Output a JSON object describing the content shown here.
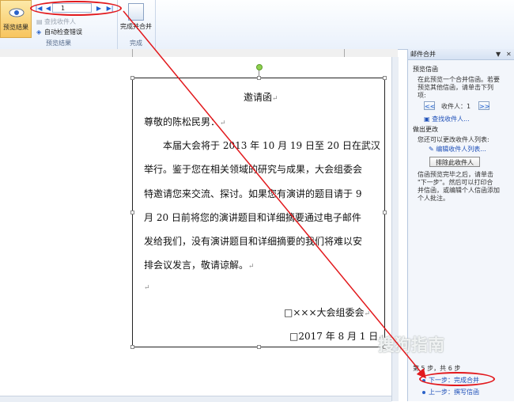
{
  "ribbon": {
    "preview_results": {
      "label": "预览结果"
    },
    "record": {
      "value": "1"
    },
    "find_recipient": "查找收件人",
    "auto_check": "自动检查错误",
    "group_preview": "预览结果",
    "finish_merge": "完成并合并",
    "group_finish": "完成"
  },
  "document": {
    "title": "邀请函",
    "greeting": "尊敬的陈松民男：",
    "lines": [
      "本届大会将于 2013 年 10 月 19 日至 20 日在武汉",
      "举行。鉴于您在相关领域的研究与成果，大会组委会",
      "特邀请您来交流、探讨。如果您有演讲的题目请于 9",
      "月 20 日前将您的演讲题目和详细摘要通过电子邮件",
      "发给我们，没有演讲题目和详细摘要的我们将难以安",
      "排会议发言，敬请谅解。"
    ],
    "signature": "□×××大会组委会",
    "date": "□2017 年 8 月 1 日"
  },
  "pane": {
    "title": "邮件合并",
    "sec_preview": "预览信函",
    "preview_desc": [
      "在此预览一个合并信函。若要",
      "预览其他信函，请单击下列",
      "项:"
    ],
    "recipient_label": "收件人：1",
    "find_link": "查找收件人...",
    "sec_changes": "做出更改",
    "changes_desc": "您还可以更改收件人列表:",
    "edit_link": "编辑收件人列表...",
    "exclude_btn": "排除此收件人",
    "after_desc": [
      "信函预览完毕之后，请单击",
      "\"下一步\"。然后可以打印合",
      "并信函，或编辑个人信函添加",
      "个人批注。"
    ],
    "step_text": "第 5 步，共 6 步",
    "next_step": "下一步：完成合并",
    "prev_step": "上一步：撰写信函"
  },
  "watermark": "搜狗指南",
  "colors": {
    "accent": "#e2191d",
    "link": "#1d4fb8"
  }
}
